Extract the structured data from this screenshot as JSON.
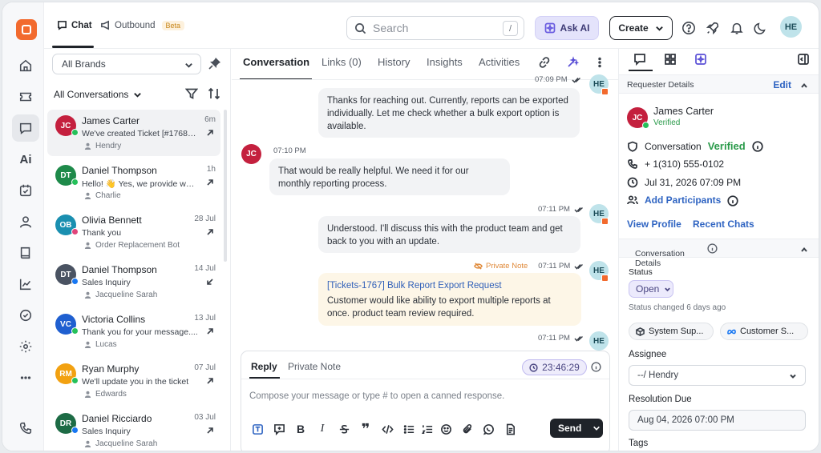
{
  "topbar": {
    "tabs": [
      {
        "label": "Chat"
      },
      {
        "label": "Outbound",
        "badge": "Beta"
      }
    ],
    "search_placeholder": "Search",
    "search_shortcut": "/",
    "ask_ai": "Ask AI",
    "create": "Create",
    "user_initials": "HE"
  },
  "rail": {
    "ai_label": "Ai"
  },
  "list": {
    "brand_select": "All Brands",
    "view_select": "All Conversations",
    "conversations": [
      {
        "initials": "JC",
        "color": "#c4203e",
        "channel": "#25c05a",
        "name": "James Carter",
        "date": "6m",
        "message": "We've created Ticket [#17689]...",
        "agent": "Hendry"
      },
      {
        "initials": "DT",
        "color": "#1e8a4a",
        "channel": "#25c05a",
        "name": "Daniel Thompson",
        "date": "1h",
        "message": "Hello! 👋 Yes, we provide workf...",
        "agent": "Charlie"
      },
      {
        "initials": "OB",
        "color": "#1a8fb0",
        "channel": "#e0447a",
        "name": "Olivia Bennett",
        "date": "28 Jul",
        "message": "Thank you",
        "agent": "Order Replacement Bot"
      },
      {
        "initials": "DT",
        "color": "#4a5362",
        "channel": "#1877f2",
        "name": "Daniel Thompson",
        "date": "14 Jul",
        "message": "Sales Inquiry",
        "agent": "Jacqueline Sarah"
      },
      {
        "initials": "VC",
        "color": "#1f5fd0",
        "channel": "#25c05a",
        "name": "Victoria Collins",
        "date": "13 Jul",
        "message": "Thank you for your message....",
        "agent": "Lucas"
      },
      {
        "initials": "RM",
        "color": "#f2a111",
        "channel": "#25c05a",
        "name": "Ryan Murphy",
        "date": "07 Jul",
        "message": "We'll update you in the ticket",
        "agent": "Edwards"
      },
      {
        "initials": "DR",
        "color": "#1d6b45",
        "channel": "#1877f2",
        "name": "Daniel Ricciardo",
        "date": "03 Jul",
        "message": "Sales Inquiry",
        "agent": "Jacqueline Sarah"
      }
    ]
  },
  "center": {
    "tabs": [
      {
        "label": "Conversation"
      },
      {
        "label": "Links (0)"
      },
      {
        "label": "History"
      },
      {
        "label": "Insights"
      },
      {
        "label": "Activities"
      }
    ],
    "messages": {
      "m1": {
        "text": "Thanks for reaching out. Currently, reports can be exported individually. Let me check whether a bulk export option is available.",
        "time": "07:09 PM",
        "author": "HE"
      },
      "m2": {
        "text": "That would be really helpful. We need it for our monthly reporting process.",
        "time": "07:10 PM",
        "author": "JC"
      },
      "m3": {
        "text": "Understood. I'll discuss this with the product team and get back to you with an update.",
        "time": "07:11 PM",
        "author": "HE"
      },
      "m4": {
        "note_label": "Private Note",
        "ticket": "[Tickets-1767] Bulk Report Export Request",
        "text": "Customer would like ability to export multiple reports at once. product team review required.",
        "time": "07:11 PM",
        "author": "HE"
      },
      "m5": {
        "time": "07:11 PM",
        "author": "HE"
      }
    },
    "composer": {
      "tabs": [
        {
          "label": "Reply"
        },
        {
          "label": "Private Note"
        }
      ],
      "timer": "23:46:29",
      "placeholder": "Compose your message or type # to open a canned response.",
      "send": "Send"
    }
  },
  "right": {
    "requester_header": "Requester Details",
    "edit": "Edit",
    "name": "James Carter",
    "initials": "JC",
    "verified_small": "Verified",
    "conversation_label": "Conversation",
    "conversation_status": "Verified",
    "phone": "+ 1(310) 555-0102",
    "datetime": "Jul 31, 2026 07:09 PM",
    "add_participants": "Add Participants",
    "view_profile": "View Profile",
    "recent_chats": "Recent Chats",
    "conv_details_header": "Conversation Details",
    "status_label": "Status",
    "status_value": "Open",
    "status_changed": "Status changed 6 days ago",
    "chips": [
      "System Sup...",
      "Customer S..."
    ],
    "assignee_label": "Assignee",
    "assignee_value": "--/ Hendry",
    "resolution_label": "Resolution Due",
    "resolution_value": "Aug 04, 2026 07:00 PM",
    "tags_label": "Tags"
  }
}
